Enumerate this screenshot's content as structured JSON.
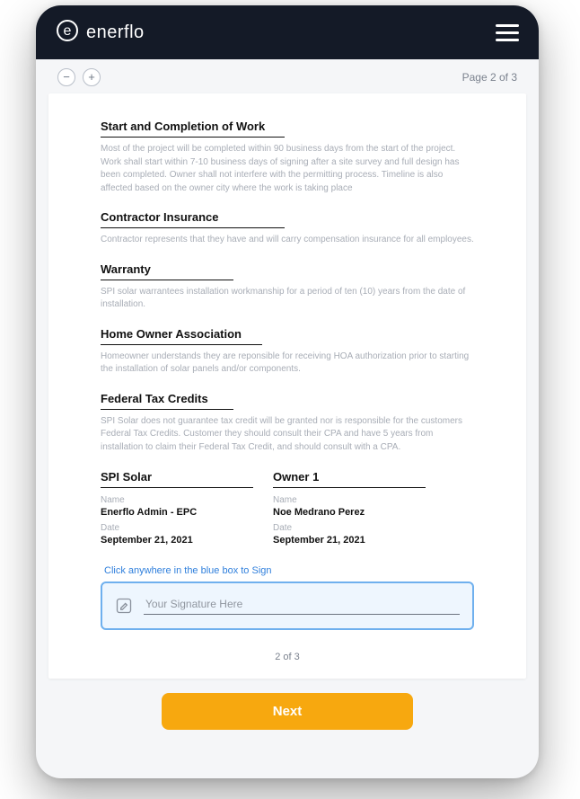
{
  "header": {
    "brand": "enerflo"
  },
  "toolbar": {
    "zoom_out": "−",
    "zoom_in": "+",
    "page_indicator_top": "Page 2 of 3"
  },
  "sections": [
    {
      "title": "Start and Completion of Work",
      "body": "Most of the  project will be completed within 90 business days from the start of the project. Work shall start within 7-10 business days of signing after a site survey and full design has been completed. Owner shall not interfere with the permitting process. Timeline is also affected based on the owner city where the work is taking place"
    },
    {
      "title": "Contractor Insurance",
      "body": "Contractor represents that they have and will carry compensation insurance for all employees."
    },
    {
      "title": "Warranty",
      "body": "SPI solar warrantees installation workmanship for a period of ten (10) years from the date of installation."
    },
    {
      "title": "Home Owner Association",
      "body": "Homeowner understands they are reponsible for receiving HOA authorization prior to starting the installation of solar panels and/or components."
    },
    {
      "title": "Federal Tax Credits",
      "body": "SPI Solar does not guarantee tax credit will be granted nor is responsible for the customers Federal Tax Credits. Customer they should consult their CPA and have 5 years from installation to claim their Federal Tax Credit, and should consult with a CPA."
    }
  ],
  "signatures": [
    {
      "party": "SPI Solar",
      "name_label": "Name",
      "name": "Enerflo Admin - EPC",
      "date_label": "Date",
      "date": "September 21, 2021"
    },
    {
      "party": "Owner 1",
      "name_label": "Name",
      "name": "Noe Medrano Perez",
      "date_label": "Date",
      "date": "September 21, 2021"
    }
  ],
  "signature_box": {
    "prompt": "Click anywhere in the blue box to Sign",
    "placeholder": "Your Signature Here"
  },
  "footer": {
    "page_indicator_bottom": "2 of 3",
    "next_label": "Next"
  }
}
